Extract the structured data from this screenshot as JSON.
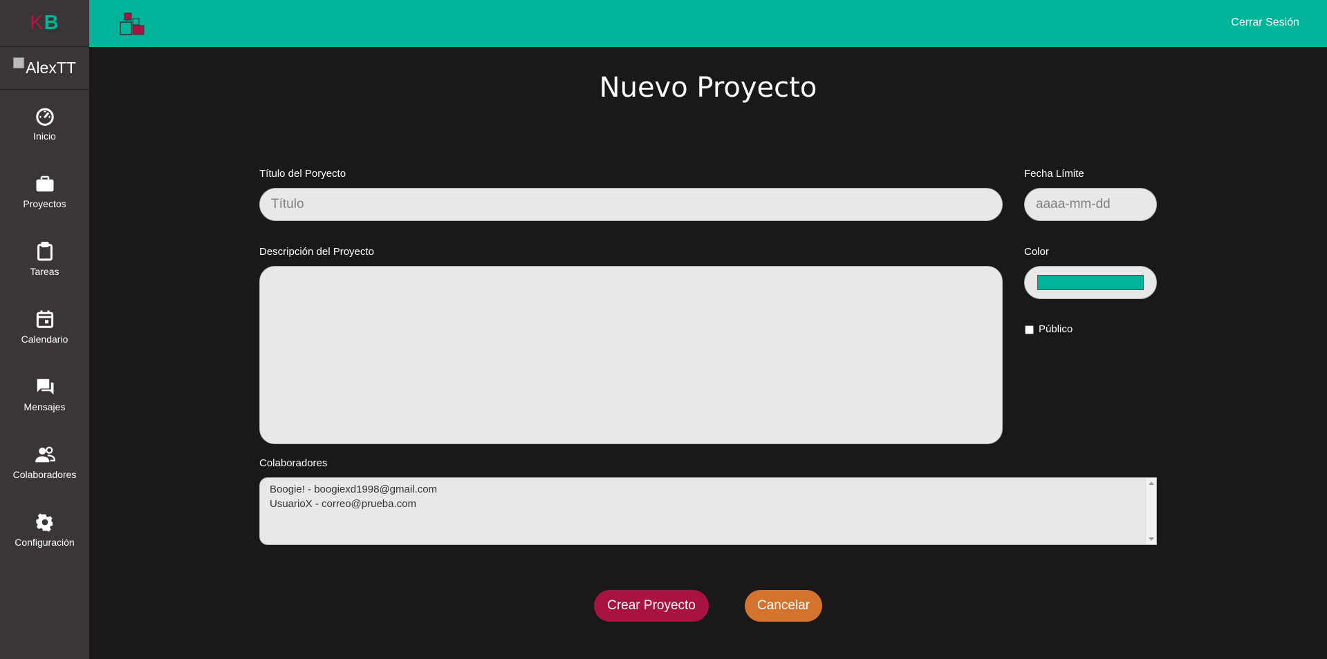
{
  "brand": {
    "k": "K",
    "b": "B"
  },
  "user": {
    "avatar_alt": "AlexTT"
  },
  "sidebar": {
    "items": [
      {
        "label": "Inicio",
        "icon": "speedometer-icon"
      },
      {
        "label": "Proyectos",
        "icon": "briefcase-icon"
      },
      {
        "label": "Tareas",
        "icon": "clipboard-icon"
      },
      {
        "label": "Calendario",
        "icon": "calendar-icon"
      },
      {
        "label": "Mensajes",
        "icon": "chat-bubbles-icon"
      },
      {
        "label": "Colaboradores",
        "icon": "users-icon"
      },
      {
        "label": "Configuración",
        "icon": "gear-icon"
      }
    ]
  },
  "header": {
    "logout_label": "Cerrar Sesión"
  },
  "form": {
    "title": "Nuevo Proyecto",
    "project_title": {
      "label": "Título del Poryecto",
      "placeholder": "Título",
      "value": ""
    },
    "deadline": {
      "label": "Fecha Límite",
      "placeholder": "aaaa-mm-dd",
      "value": ""
    },
    "description": {
      "label": "Descripción del Proyecto",
      "value": ""
    },
    "color": {
      "label": "Color",
      "value": "#00b399"
    },
    "public": {
      "label": "Público",
      "checked": false
    },
    "collaborators": {
      "label": "Colaboradores",
      "options": [
        "Boogie! - boogiexd1998@gmail.com",
        "UsuarioX - correo@prueba.com"
      ]
    },
    "submit_label": "Crear Proyecto",
    "cancel_label": "Cancelar"
  },
  "colors": {
    "teal": "#00b399",
    "crimson": "#a8133f",
    "orange": "#d4732d",
    "sidebar_bg": "#3a3637",
    "page_bg": "#1b1819"
  }
}
